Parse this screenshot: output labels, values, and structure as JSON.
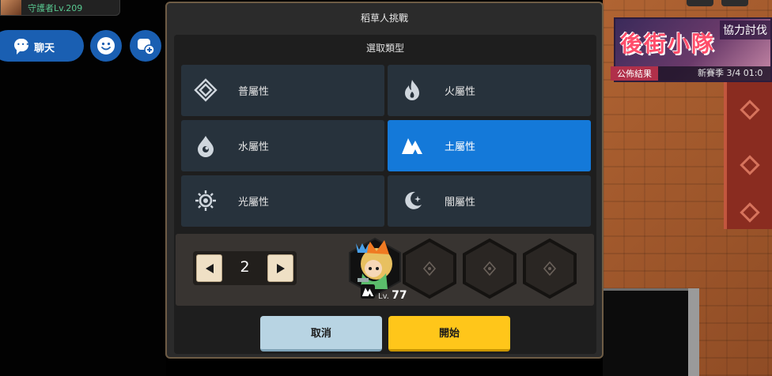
{
  "player": {
    "title": "守護者Lv.209"
  },
  "chat": {
    "label": "聊天"
  },
  "event_banner": {
    "title": "後街小隊",
    "badge": "協力討伐",
    "result_label": "公佈結果",
    "season_text": "新賽季 3/4 01:0"
  },
  "dialog": {
    "title": "稻草人挑戰",
    "section_title": "選取類型",
    "types": [
      {
        "label": "普屬性",
        "icon": "basic-element-icon",
        "selected": false
      },
      {
        "label": "火屬性",
        "icon": "fire-element-icon",
        "selected": false
      },
      {
        "label": "水屬性",
        "icon": "water-element-icon",
        "selected": false
      },
      {
        "label": "土屬性",
        "icon": "earth-element-icon",
        "selected": true
      },
      {
        "label": "光屬性",
        "icon": "light-element-icon",
        "selected": false
      },
      {
        "label": "闇屬性",
        "icon": "dark-element-icon",
        "selected": false
      }
    ],
    "team_count": "2",
    "hero": {
      "level_prefix": "Lv.",
      "level": "77",
      "element_icon": "earth-element-icon"
    },
    "empty_slots": 3,
    "cancel_label": "取消",
    "start_label": "開始"
  },
  "colors": {
    "selected": "#1479d9",
    "type_button": "#27323c",
    "cancel": "#b8d4e3",
    "start": "#ffc61a",
    "accent_blue": "#1a5fb2"
  }
}
